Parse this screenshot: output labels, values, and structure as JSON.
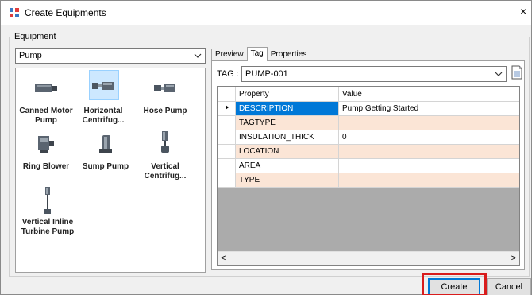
{
  "window": {
    "title": "Create Equipments",
    "close_glyph": "×"
  },
  "equipment_group": {
    "label": "Equipment",
    "type_selected": "Pump",
    "items": [
      {
        "label": "Canned Motor Pump",
        "icon": "canned-motor-pump-icon"
      },
      {
        "label": "Horizontal Centrifug...",
        "icon": "horizontal-centrifugal-pump-icon",
        "selected": true
      },
      {
        "label": "Hose Pump",
        "icon": "hose-pump-icon"
      },
      {
        "label": "Ring Blower",
        "icon": "ring-blower-icon"
      },
      {
        "label": "Sump Pump",
        "icon": "sump-pump-icon"
      },
      {
        "label": "Vertical Centrifug...",
        "icon": "vertical-centrifugal-pump-icon"
      },
      {
        "label": "Vertical Inline Turbine Pump",
        "icon": "vertical-inline-turbine-pump-icon"
      }
    ]
  },
  "tabs": [
    {
      "label": "Preview"
    },
    {
      "label": "Tag",
      "active": true
    },
    {
      "label": "Properties"
    }
  ],
  "tag": {
    "label": "TAG :",
    "value": "PUMP-001"
  },
  "grid": {
    "col_property": "Property",
    "col_value": "Value",
    "rows": [
      {
        "property": "DESCRIPTION",
        "value": "Pump Getting Started",
        "current": true
      },
      {
        "property": "TAGTYPE",
        "value": ""
      },
      {
        "property": "INSULATION_THICK",
        "value": "0"
      },
      {
        "property": "LOCATION",
        "value": ""
      },
      {
        "property": "AREA",
        "value": ""
      },
      {
        "property": "TYPE",
        "value": ""
      }
    ],
    "scroll_left": "<",
    "scroll_right": ">"
  },
  "buttons": {
    "create": "Create",
    "cancel": "Cancel"
  },
  "colors": {
    "accent": "#0078d7",
    "highlight_box": "#d91c1c",
    "alt_row": "#fbe5d6"
  }
}
